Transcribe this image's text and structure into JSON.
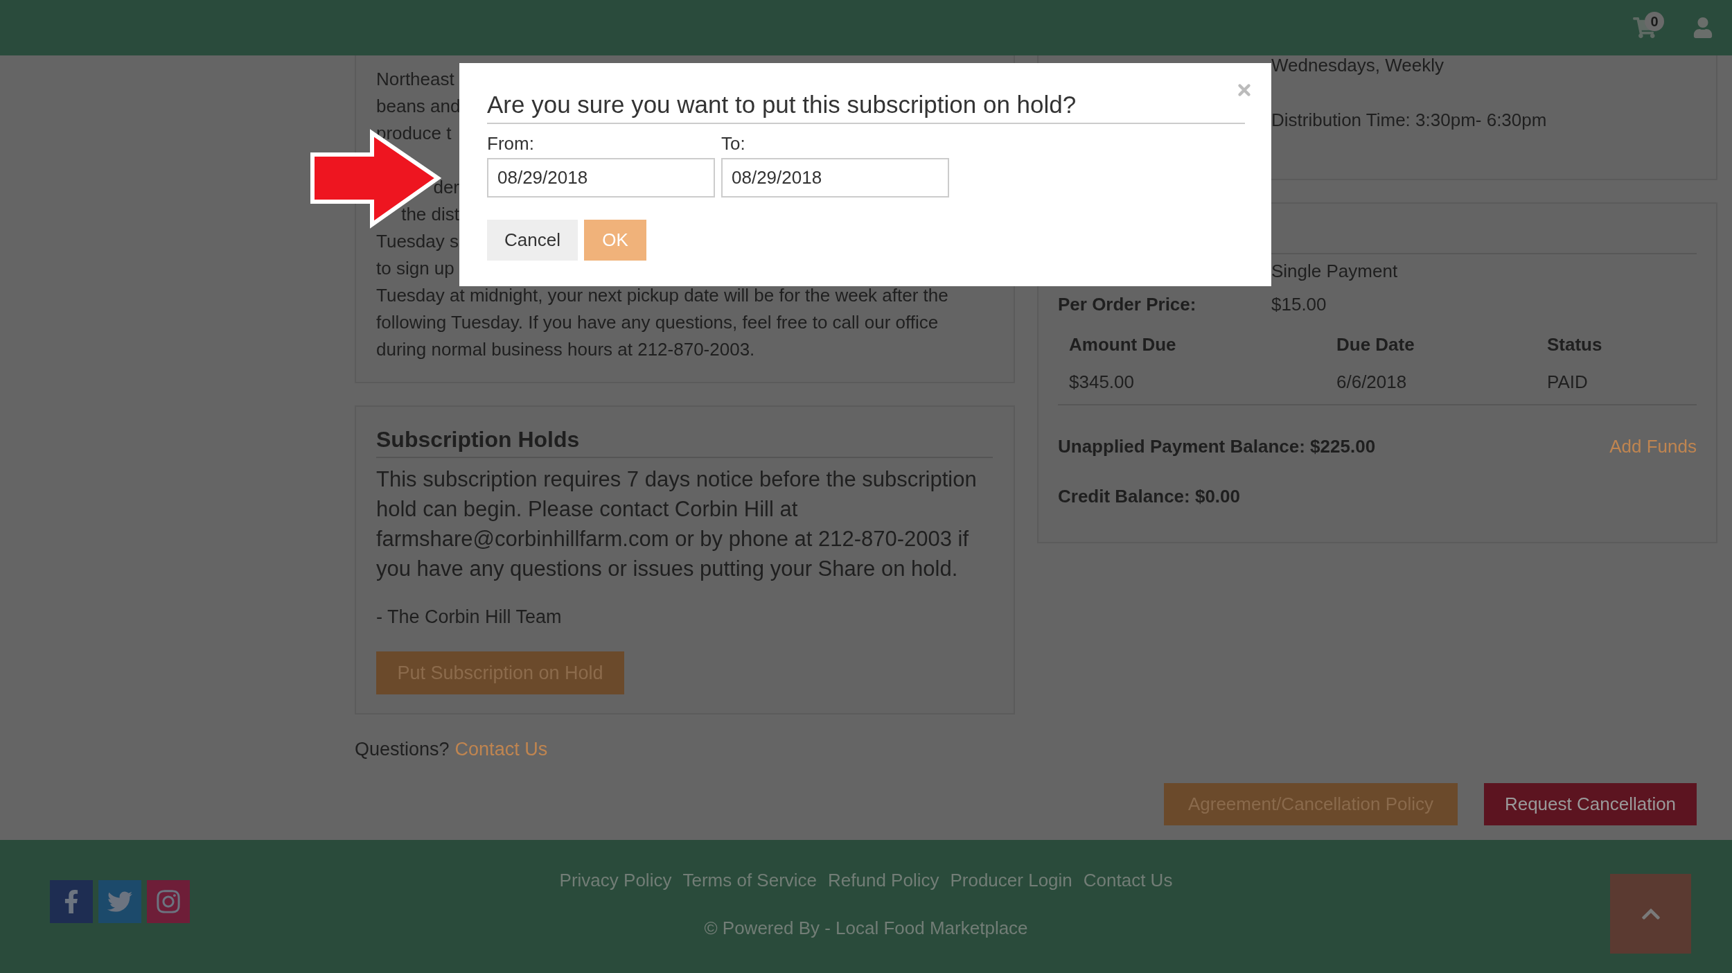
{
  "header": {
    "cart_count": "0"
  },
  "intro_card": {
    "paragraphs": [
      [
        {
          "kind": "head",
          "text": "Northeast"
        },
        {
          "kind": "head",
          "text": "beans and"
        },
        {
          "kind": "head",
          "text": "produce t"
        }
      ],
      [
        {
          "kind": "tail",
          "text": "der"
        },
        {
          "kind": "tail",
          "text": "the dist"
        },
        {
          "kind": "head",
          "text": "Tuesday s"
        },
        {
          "kind": "head",
          "text": "to sign up"
        },
        {
          "kind": "line",
          "text": "Tuesday at midnight, your next pickup date will be for the week after the"
        },
        {
          "kind": "line",
          "text": "following Tuesday. If you have any questions, feel free to call our office"
        },
        {
          "kind": "line",
          "text": "during normal business hours at 212-870-2003."
        }
      ]
    ]
  },
  "holds_card": {
    "title": "Subscription Holds",
    "body": "This subscription requires 7 days notice before the subscription hold can begin. Please contact Corbin Hill at farmshare@corbinhillfarm.com or by phone at 212-870-2003 if you have any questions or issues putting your Share on hold.",
    "signature": "- The Corbin Hill Team",
    "button": "Put Subscription on Hold"
  },
  "questions": {
    "text": "Questions?",
    "link": "Contact Us"
  },
  "schedule_card": {
    "lines": [
      "Wednesdays, Weekly",
      "Distribution Time: 3:30pm- 6:30pm"
    ]
  },
  "billing_card": {
    "payment_type": "Single Payment",
    "price_label": "Per Order Price:",
    "price": "$15.00",
    "columns": [
      "Amount Due",
      "Due Date",
      "Status"
    ],
    "rows": [
      [
        "$345.00",
        "6/6/2018",
        "PAID"
      ]
    ],
    "unapplied": "Unapplied Payment Balance: $225.00",
    "add_funds": "Add Funds",
    "credit": "Credit Balance: $0.00"
  },
  "actions": [
    "Agreement/Cancellation Policy",
    "Request Cancellation"
  ],
  "footer": {
    "links": [
      "Privacy Policy",
      "Terms of Service",
      "Refund Policy",
      "Producer Login",
      "Contact Us"
    ],
    "powered": "© Powered By - Local Food Marketplace"
  },
  "modal": {
    "title": "Are you sure you want to put this subscription on hold?",
    "from_label": "From:",
    "from_value": "08/29/2018",
    "to_label": "To:",
    "to_value": "08/29/2018",
    "cancel": "Cancel",
    "ok": "OK"
  }
}
